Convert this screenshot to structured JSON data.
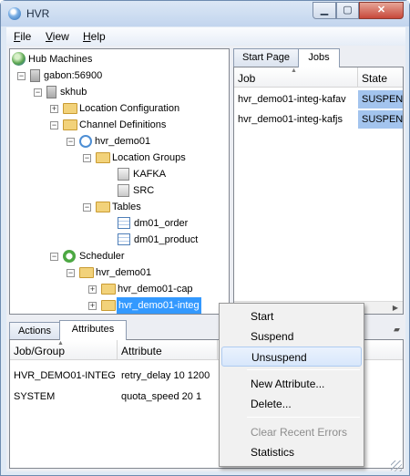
{
  "window": {
    "title": "HVR"
  },
  "menu": {
    "file": "File",
    "file_rest": "ile",
    "file_key": "F",
    "view_key": "V",
    "view_rest": "iew",
    "help_key": "H",
    "help_rest": "elp"
  },
  "tree": {
    "root": "Hub Machines",
    "server": "gabon:56900",
    "hub": "skhub",
    "location_config": "Location Configuration",
    "channel_defs": "Channel Definitions",
    "channel": "hvr_demo01",
    "location_groups": "Location Groups",
    "loc_kafka": "KAFKA",
    "loc_src": "SRC",
    "tables": "Tables",
    "table1": "dm01_order",
    "table2": "dm01_product",
    "scheduler": "Scheduler",
    "sched_group": "hvr_demo01",
    "job_cap": "hvr_demo01-cap",
    "job_integ": "hvr_demo01-integ"
  },
  "right_tabs": {
    "start_page": "Start Page",
    "jobs": "Jobs"
  },
  "jobs_table": {
    "headers": {
      "job": "Job",
      "state": "State"
    },
    "rows": [
      {
        "job": "hvr_demo01-integ-kafav",
        "state": "SUSPEND"
      },
      {
        "job": "hvr_demo01-integ-kafjs",
        "state": "SUSPEND"
      }
    ]
  },
  "bottom_tabs": {
    "actions": "Actions",
    "attributes": "Attributes"
  },
  "attributes_table": {
    "headers": {
      "group": "Job/Group",
      "attribute": "Attribute"
    },
    "rows": [
      {
        "group": "HVR_DEMO01-INTEG",
        "attribute": "retry_delay 10 1200"
      },
      {
        "group": "SYSTEM",
        "attribute": "quota_speed 20 1"
      }
    ]
  },
  "context_menu": {
    "start": "Start",
    "suspend": "Suspend",
    "unsuspend": "Unsuspend",
    "new_attribute": "New Attribute...",
    "delete": "Delete...",
    "clear_errors": "Clear Recent Errors",
    "statistics": "Statistics"
  }
}
